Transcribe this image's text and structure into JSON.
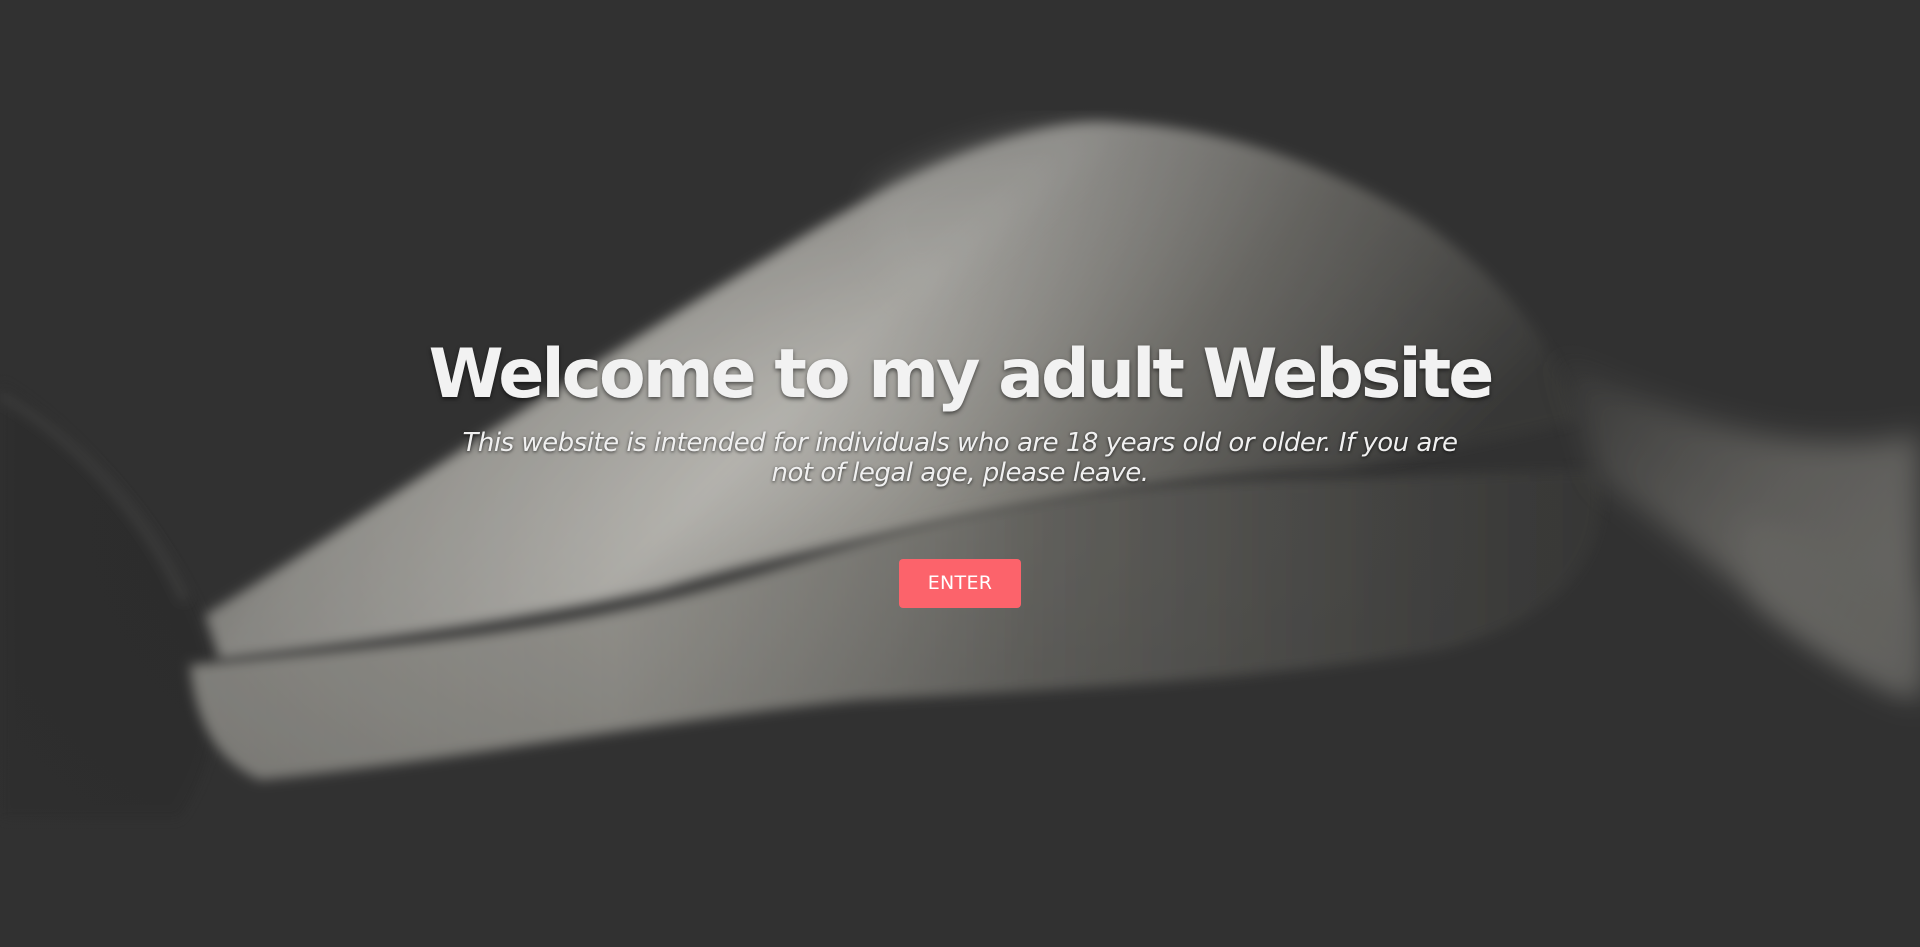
{
  "hero": {
    "title": "Welcome to my adult Website",
    "notice": "This website is intended for individuals who are 18 years old or older. If you are not of legal age, please leave.",
    "enter_label": "ENTER"
  },
  "colors": {
    "background": "#333333",
    "button": "#fc636b",
    "text": "#f2f2f2"
  }
}
